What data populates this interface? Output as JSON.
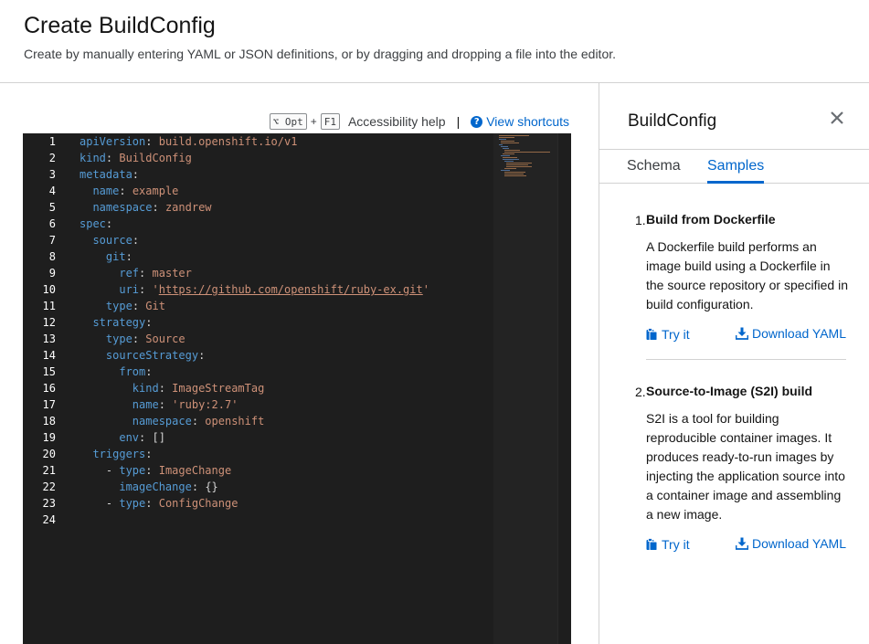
{
  "page": {
    "title": "Create BuildConfig",
    "subtitle": "Create by manually entering YAML or JSON definitions, or by dragging and dropping a file into the editor."
  },
  "toolbar": {
    "key1": "⌥ Opt",
    "plus": "+",
    "key2": "F1",
    "accessibility_help": "Accessibility help",
    "separator": "|",
    "view_shortcuts": "View shortcuts"
  },
  "editor": {
    "line_numbers": [
      "1",
      "2",
      "3",
      "4",
      "5",
      "6",
      "7",
      "8",
      "9",
      "10",
      "11",
      "12",
      "13",
      "14",
      "15",
      "16",
      "17",
      "18",
      "19",
      "20",
      "21",
      "22",
      "23",
      "24"
    ],
    "lines": [
      {
        "indent": "",
        "key": "apiVersion",
        "value": "build.openshift.io/v1"
      },
      {
        "indent": "",
        "key": "kind",
        "value": "BuildConfig"
      },
      {
        "indent": "",
        "key": "metadata",
        "value": ""
      },
      {
        "indent": "  ",
        "key": "name",
        "value": "example"
      },
      {
        "indent": "  ",
        "key": "namespace",
        "value": "zandrew"
      },
      {
        "indent": "",
        "key": "spec",
        "value": ""
      },
      {
        "indent": "  ",
        "key": "source",
        "value": ""
      },
      {
        "indent": "    ",
        "key": "git",
        "value": ""
      },
      {
        "indent": "      ",
        "key": "ref",
        "value": "master"
      },
      {
        "indent": "      ",
        "key": "uri",
        "value": "'https://github.com/openshift/ruby-ex.git'"
      },
      {
        "indent": "    ",
        "key": "type",
        "value": "Git"
      },
      {
        "indent": "  ",
        "key": "strategy",
        "value": ""
      },
      {
        "indent": "    ",
        "key": "type",
        "value": "Source"
      },
      {
        "indent": "    ",
        "key": "sourceStrategy",
        "value": ""
      },
      {
        "indent": "      ",
        "key": "from",
        "value": ""
      },
      {
        "indent": "        ",
        "key": "kind",
        "value": "ImageStreamTag"
      },
      {
        "indent": "        ",
        "key": "name",
        "value": "'ruby:2.7'"
      },
      {
        "indent": "        ",
        "key": "namespace",
        "value": "openshift"
      },
      {
        "indent": "      ",
        "key": "env",
        "value": "[]"
      },
      {
        "indent": "  ",
        "key": "triggers",
        "value": ""
      },
      {
        "indent": "    - ",
        "key": "type",
        "value": "ImageChange"
      },
      {
        "indent": "      ",
        "key": "imageChange",
        "value": "{}"
      },
      {
        "indent": "    - ",
        "key": "type",
        "value": "ConfigChange"
      },
      {
        "indent": "",
        "key": "",
        "value": ""
      }
    ]
  },
  "side_panel": {
    "title": "BuildConfig",
    "tabs": [
      {
        "label": "Schema",
        "active": false
      },
      {
        "label": "Samples",
        "active": true
      }
    ],
    "samples": [
      {
        "number": "1.",
        "title": "Build from Dockerfile",
        "description": "A Dockerfile build performs an image build using a Dockerfile in the source repository or specified in build configuration.",
        "try_it": "Try it",
        "download": "Download YAML"
      },
      {
        "number": "2.",
        "title": "Source-to-Image (S2I) build",
        "description": "S2I is a tool for building reproducible container images. It produces ready-to-run images by injecting the application source into a container image and assembling a new image.",
        "try_it": "Try it",
        "download": "Download YAML"
      }
    ]
  },
  "colors": {
    "link": "#0066cc",
    "editor_bg": "#1e1e1e",
    "yaml_key": "#569cd6",
    "yaml_value": "#ce9178"
  }
}
